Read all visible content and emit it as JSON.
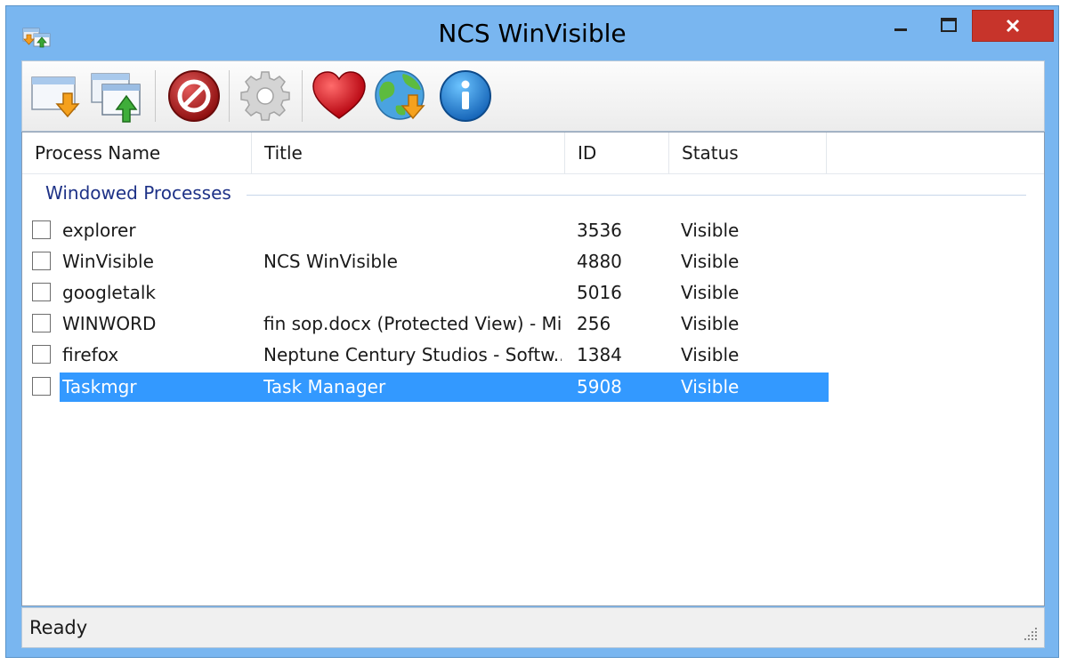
{
  "window": {
    "title": "NCS WinVisible"
  },
  "toolbar": {
    "buttons": [
      {
        "icon": "window-arrow-down-icon"
      },
      {
        "icon": "windows-arrow-up-icon"
      },
      {
        "icon": "stop-icon"
      },
      {
        "icon": "gear-icon"
      },
      {
        "icon": "heart-icon"
      },
      {
        "icon": "globe-download-icon"
      },
      {
        "icon": "info-icon"
      }
    ]
  },
  "table": {
    "columns": [
      "Process Name",
      "Title",
      "ID",
      "Status"
    ],
    "group": "Windowed Processes",
    "rows": [
      {
        "name": "explorer",
        "title": "",
        "id": "3536",
        "status": "Visible",
        "checked": false,
        "selected": false
      },
      {
        "name": "WinVisible",
        "title": "NCS WinVisible",
        "id": "4880",
        "status": "Visible",
        "checked": false,
        "selected": false
      },
      {
        "name": "googletalk",
        "title": "",
        "id": "5016",
        "status": "Visible",
        "checked": false,
        "selected": false
      },
      {
        "name": "WINWORD",
        "title": "fin sop.docx (Protected View) - Mi...",
        "id": "256",
        "status": "Visible",
        "checked": false,
        "selected": false
      },
      {
        "name": "firefox",
        "title": "Neptune Century Studios - Softw...",
        "id": "1384",
        "status": "Visible",
        "checked": false,
        "selected": false
      },
      {
        "name": "Taskmgr",
        "title": "Task Manager",
        "id": "5908",
        "status": "Visible",
        "checked": false,
        "selected": true
      }
    ]
  },
  "statusbar": {
    "text": "Ready"
  },
  "colors": {
    "titlebar": "#79b6f0",
    "selection": "#3399ff",
    "close": "#c7342b",
    "group": "#1e3287"
  }
}
